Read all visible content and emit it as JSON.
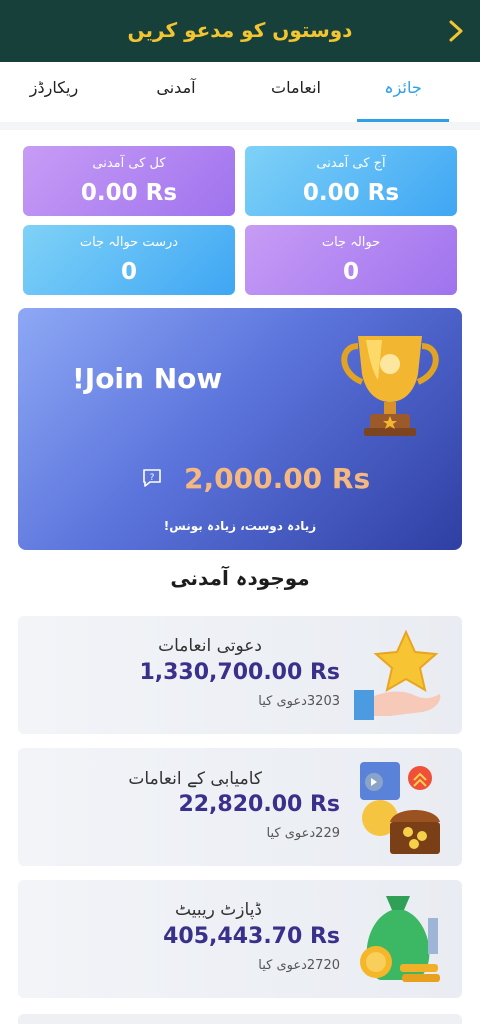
{
  "header": {
    "title": "دوستوں کو مدعو کریں",
    "back_icon": "chevron-right-icon",
    "color": "#17403a",
    "title_color": "#f3c531"
  },
  "tabs": [
    {
      "label": "جائزہ",
      "active": true
    },
    {
      "label": "انعامات",
      "active": false
    },
    {
      "label": "آمدنی",
      "active": false
    },
    {
      "label": "ریکارڈز",
      "active": false
    }
  ],
  "stats": {
    "today_income": {
      "label": "آج کی آمدنی",
      "value": "0.00 Rs"
    },
    "total_income": {
      "label": "کل کی آمدنی",
      "value": "0.00 Rs"
    },
    "referrals": {
      "label": "حوالہ جات",
      "value": "0"
    },
    "valid_referrals": {
      "label": "درست حوالہ جات",
      "value": "0"
    }
  },
  "banner": {
    "title": "!Join Now",
    "amount": "2,000.00 Rs",
    "subtitle": "زیادہ دوست، زیادہ بونس!",
    "icon": "trophy-icon"
  },
  "section_title": "موجودہ آمدنی",
  "earnings": [
    {
      "title": "دعوتی انعامات",
      "amount": "1,330,700.00 Rs",
      "count": "3203دعوی کیا",
      "icon": "star-hand-icon"
    },
    {
      "title": "کامیابی کے انعامات",
      "amount": "22,820.00 Rs",
      "count": "229دعوی کیا",
      "icon": "treasure-chest-icon"
    },
    {
      "title": "ڈپازٹ ریبیٹ",
      "amount": "405,443.70 Rs",
      "count": "2720دعوی کیا",
      "icon": "money-bag-icon"
    }
  ],
  "colors": {
    "accent": "#2ea0ea",
    "amount": "#3a2f8a",
    "banner_amount": "#f4b880"
  }
}
